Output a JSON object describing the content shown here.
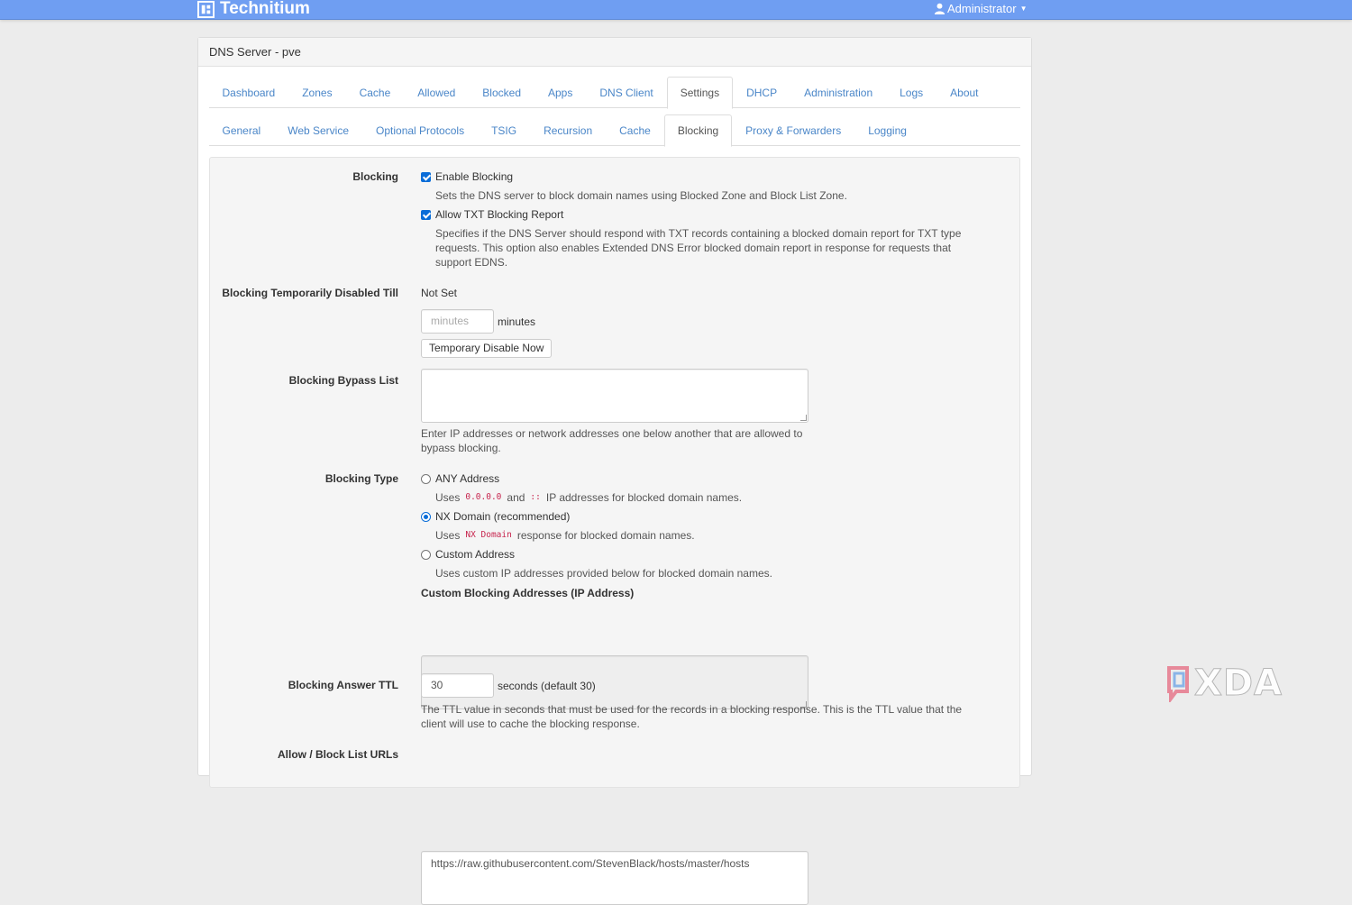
{
  "app": {
    "brand": "Technitium",
    "user_menu": "Administrator",
    "watermark": "XDA"
  },
  "panel": {
    "title": "DNS Server - pve"
  },
  "main_tabs": [
    {
      "label": "Dashboard",
      "active": false
    },
    {
      "label": "Zones",
      "active": false
    },
    {
      "label": "Cache",
      "active": false
    },
    {
      "label": "Allowed",
      "active": false
    },
    {
      "label": "Blocked",
      "active": false
    },
    {
      "label": "Apps",
      "active": false
    },
    {
      "label": "DNS Client",
      "active": false
    },
    {
      "label": "Settings",
      "active": true
    },
    {
      "label": "DHCP",
      "active": false
    },
    {
      "label": "Administration",
      "active": false
    },
    {
      "label": "Logs",
      "active": false
    },
    {
      "label": "About",
      "active": false
    }
  ],
  "sub_tabs": [
    {
      "label": "General",
      "active": false
    },
    {
      "label": "Web Service",
      "active": false
    },
    {
      "label": "Optional Protocols",
      "active": false
    },
    {
      "label": "TSIG",
      "active": false
    },
    {
      "label": "Recursion",
      "active": false
    },
    {
      "label": "Cache",
      "active": false
    },
    {
      "label": "Blocking",
      "active": true
    },
    {
      "label": "Proxy & Forwarders",
      "active": false
    },
    {
      "label": "Logging",
      "active": false
    }
  ],
  "blocking": {
    "label": "Blocking",
    "enable_label": "Enable Blocking",
    "enable_checked": true,
    "enable_help": "Sets the DNS server to block domain names using Blocked Zone and Block List Zone.",
    "txt_label": "Allow TXT Blocking Report",
    "txt_checked": true,
    "txt_help_1": "Specifies if the DNS Server should respond with TXT records containing a blocked domain report for TXT type",
    "txt_help_2": "requests. This option also enables Extended DNS Error blocked domain report in response for requests that",
    "txt_help_3": "support EDNS."
  },
  "temp_disable": {
    "label": "Blocking Temporarily Disabled Till",
    "value": "Not Set",
    "minutes_placeholder": "minutes",
    "minutes_unit": "minutes",
    "button": "Temporary Disable Now"
  },
  "bypass": {
    "label": "Blocking Bypass List",
    "value": "",
    "help_1": "Enter IP addresses or network addresses one below another that are allowed to",
    "help_2": "bypass blocking."
  },
  "blocking_type": {
    "label": "Blocking Type",
    "any_label": "ANY Address",
    "any_help_pre": "Uses",
    "any_code_1": "0.0.0.0",
    "any_help_and": "and",
    "any_code_2": "::",
    "any_help_post": "IP addresses for blocked domain names.",
    "nx_label": "NX Domain (recommended)",
    "nx_help_pre": "Uses",
    "nx_code": "NX Domain",
    "nx_help_post": "response for blocked domain names.",
    "custom_label": "Custom Address",
    "custom_help": "Uses custom IP addresses provided below for blocked domain names.",
    "selected": "nx"
  },
  "custom_addresses": {
    "label": "Custom Blocking Addresses (IP Address)",
    "value": ""
  },
  "answer_ttl": {
    "label": "Blocking Answer TTL",
    "value": "30",
    "unit": "seconds (default 30)",
    "help_1": "The TTL value in seconds that must be used for the records in a blocking response. This is the TTL value that the",
    "help_2": "client will use to cache the blocking response."
  },
  "block_list": {
    "label": "Allow / Block List URLs",
    "value": "https://raw.githubusercontent.com/StevenBlack/hosts/master/hosts"
  },
  "colors": {
    "topbar": "#6f9ef2",
    "link": "#4a86c8",
    "accent": "#0a6dd8",
    "code": "#c7254e"
  }
}
